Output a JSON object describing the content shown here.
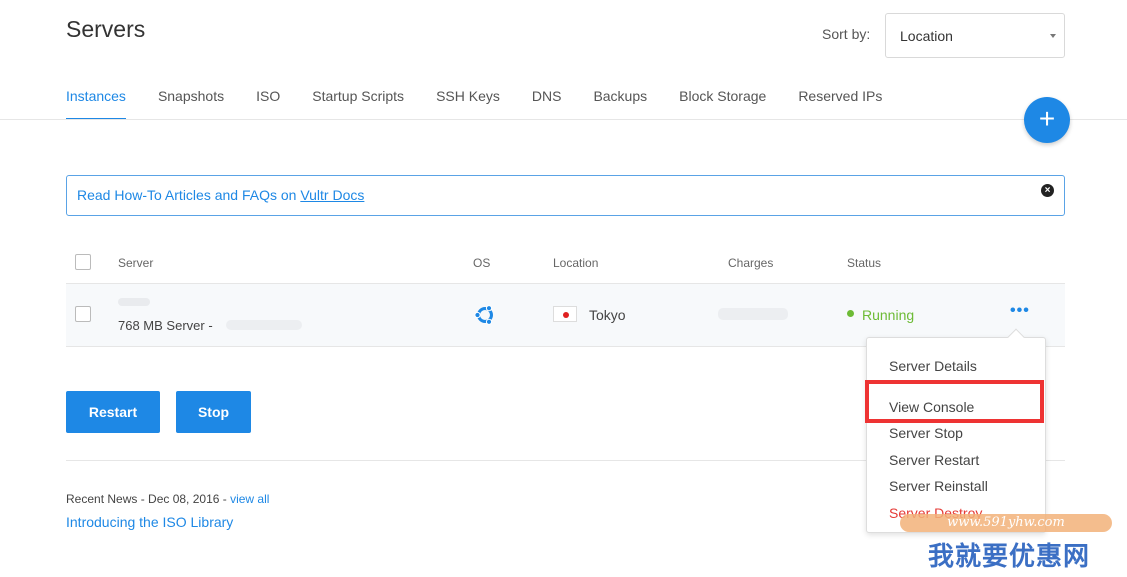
{
  "header": {
    "title": "Servers",
    "sort_label": "Sort by:",
    "sort_value": "Location"
  },
  "tabs": [
    {
      "label": "Instances",
      "active": true
    },
    {
      "label": "Snapshots"
    },
    {
      "label": "ISO"
    },
    {
      "label": "Startup Scripts"
    },
    {
      "label": "SSH Keys"
    },
    {
      "label": "DNS"
    },
    {
      "label": "Backups"
    },
    {
      "label": "Block Storage"
    },
    {
      "label": "Reserved IPs"
    }
  ],
  "add_button": {
    "label": "+"
  },
  "notice": {
    "text": "Read How-To Articles and FAQs on ",
    "link": "Vultr Docs",
    "close": "×"
  },
  "table": {
    "columns": {
      "server": "Server",
      "os": "OS",
      "location": "Location",
      "charges": "Charges",
      "status": "Status"
    },
    "rows": [
      {
        "spec": "768 MB Server - ",
        "location": "Tokyo",
        "status": "Running"
      }
    ]
  },
  "actions": {
    "restart": "Restart",
    "stop": "Stop",
    "more": "•••"
  },
  "news": {
    "prefix": "Recent News - Dec 08, 2016 - ",
    "view_all": "view all",
    "title": "Introducing the ISO Library"
  },
  "dropdown": {
    "items": [
      "Server Details",
      "View Console",
      "Server Stop",
      "Server Restart",
      "Server Reinstall",
      "Server Destroy"
    ]
  },
  "watermark": {
    "url": "www.591yhw.com",
    "cn": "我就要优惠网"
  },
  "colors": {
    "accent": "#1e88e5",
    "running": "#6dbb35",
    "danger": "#e53935",
    "highlight": "#ee3333"
  }
}
